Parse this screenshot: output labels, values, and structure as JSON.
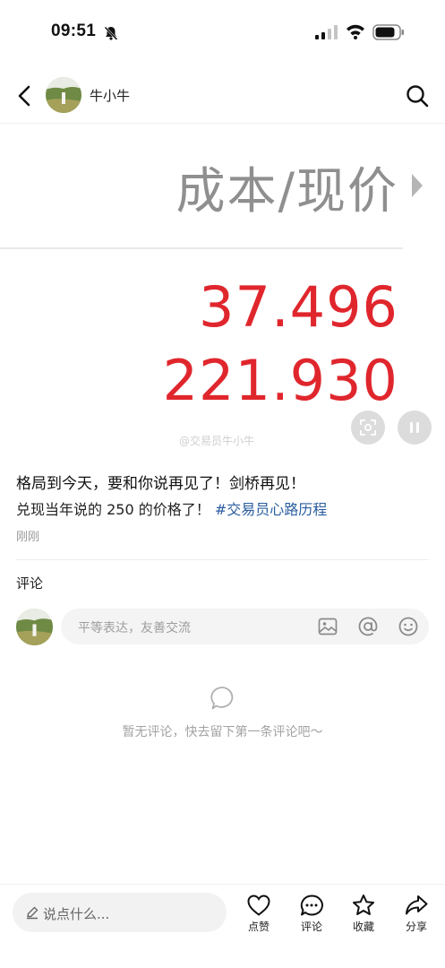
{
  "status_bar": {
    "time": "09:51"
  },
  "header": {
    "author_name": "牛小牛"
  },
  "image": {
    "title": "成本/现价",
    "value_cost": "37.496",
    "value_price": "221.930",
    "watermark": "@交易员牛小牛"
  },
  "post": {
    "title": "格局到今天，要和你说再见了！剑桥再见！",
    "body_text": "兑现当年说的 250 的价格了！",
    "hashtag": "#交易员心路历程",
    "time": "刚刚"
  },
  "comments": {
    "heading": "评论",
    "input_placeholder": "平等表达，友善交流",
    "empty_text": "暂无评论，快去留下第一条评论吧～"
  },
  "bottom_bar": {
    "say_placeholder": "说点什么...",
    "like_label": "点赞",
    "comment_label": "评论",
    "favorite_label": "收藏",
    "share_label": "分享"
  },
  "colors": {
    "price_red": "#e0262d",
    "hashtag_blue": "#2a5d9f"
  }
}
